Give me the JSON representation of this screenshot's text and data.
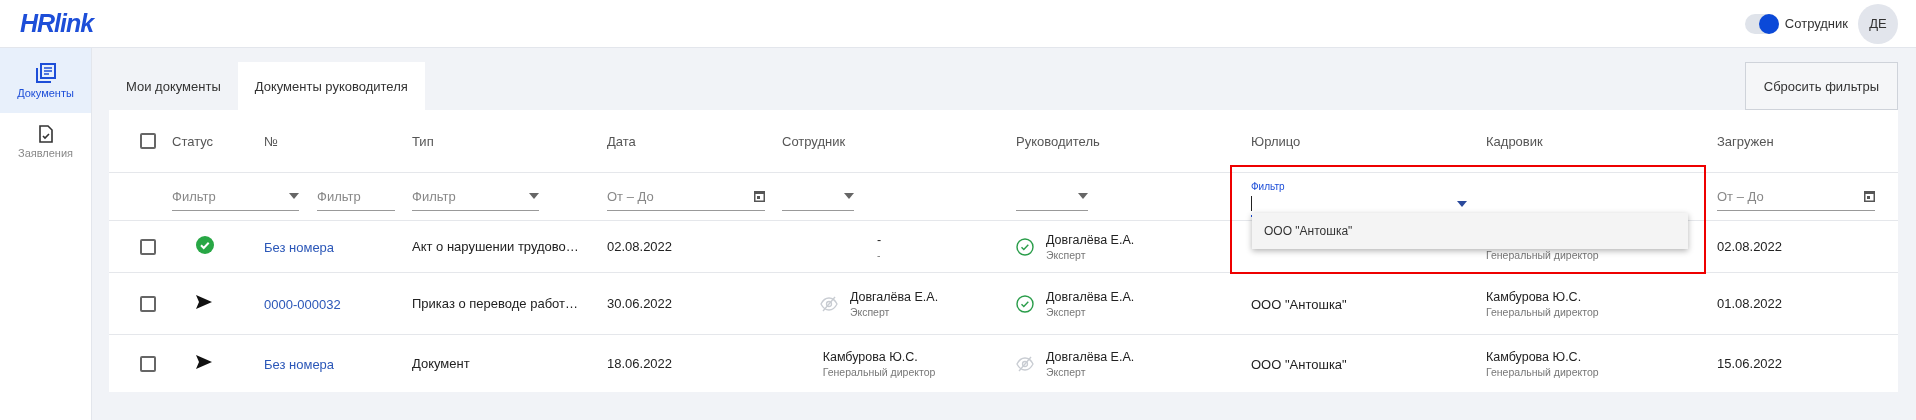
{
  "logo": "HRlink",
  "header": {
    "toggle": {
      "label": "Сотрудник",
      "on": true
    },
    "avatar": "ДЕ"
  },
  "sidebar": {
    "items": [
      {
        "label": "Документы",
        "kind": "documents",
        "selected": true
      },
      {
        "label": "Заявления",
        "kind": "request",
        "selected": false
      }
    ]
  },
  "tabs": [
    {
      "label": "Мои документы",
      "selected": false
    },
    {
      "label": "Документы руководителя",
      "selected": true
    }
  ],
  "reset_button": "Сбросить фильтры",
  "table": {
    "select_all": {
      "checked": false
    },
    "columns": [
      "Статус",
      "№",
      "Тип",
      "Дата",
      "Сотрудник",
      "Руководитель",
      "Юрлицо",
      "Кадровик",
      "Загружен"
    ],
    "filters": [
      {
        "kind": "select",
        "placeholder": "Фильтр"
      },
      {
        "kind": "text",
        "placeholder": "Фильтр"
      },
      {
        "kind": "select",
        "placeholder": "Фильтр"
      },
      {
        "kind": "date",
        "placeholder": "От – До"
      },
      {
        "kind": "select"
      },
      {
        "kind": "select"
      },
      {
        "kind": "focused",
        "label": "Фильтр"
      },
      {
        "kind": "none"
      },
      {
        "kind": "date",
        "placeholder": "От – До"
      }
    ],
    "rows": [
      {
        "checked": false,
        "kind": "signed",
        "number": "Без номера",
        "type": "Акт о нарушении трудово…",
        "date": "02.08.2022",
        "employee": {
          "name": "-",
          "role": "-"
        },
        "manager": {
          "kind": "signed",
          "name": "Довгалёва Е.А.",
          "role": "Эксперт"
        },
        "hr": {
          "role": "Генеральный директор"
        },
        "uploaded": "02.08.2022"
      },
      {
        "checked": false,
        "kind": "sent",
        "number": "0000-000032",
        "type": "Приказ о переводе работ…",
        "date": "30.06.2022",
        "employee": {
          "kind": "hidden",
          "name": "Довгалёва Е.А.",
          "role": "Эксперт"
        },
        "manager": {
          "kind": "signed",
          "name": "Довгалёва Е.А.",
          "role": "Эксперт"
        },
        "legal_entity": "ООО \"Антошка\"",
        "hr": {
          "name": "Камбурова Ю.С.",
          "role": "Генеральный директор"
        },
        "uploaded": "01.08.2022"
      },
      {
        "checked": false,
        "kind": "sent",
        "number": "Без номера",
        "type": "Документ",
        "date": "18.06.2022",
        "employee": {
          "name": "Камбурова Ю.С.",
          "role": "Генеральный директор"
        },
        "manager": {
          "kind": "hidden",
          "name": "Довгалёва Е.А.",
          "role": "Эксперт"
        },
        "legal_entity": "ООО \"Антошка\"",
        "hr": {
          "name": "Камбурова Ю.С.",
          "role": "Генеральный директор"
        },
        "uploaded": "15.06.2022"
      }
    ],
    "dropdown": {
      "options": [
        "ООО \"Антошка\""
      ]
    }
  }
}
